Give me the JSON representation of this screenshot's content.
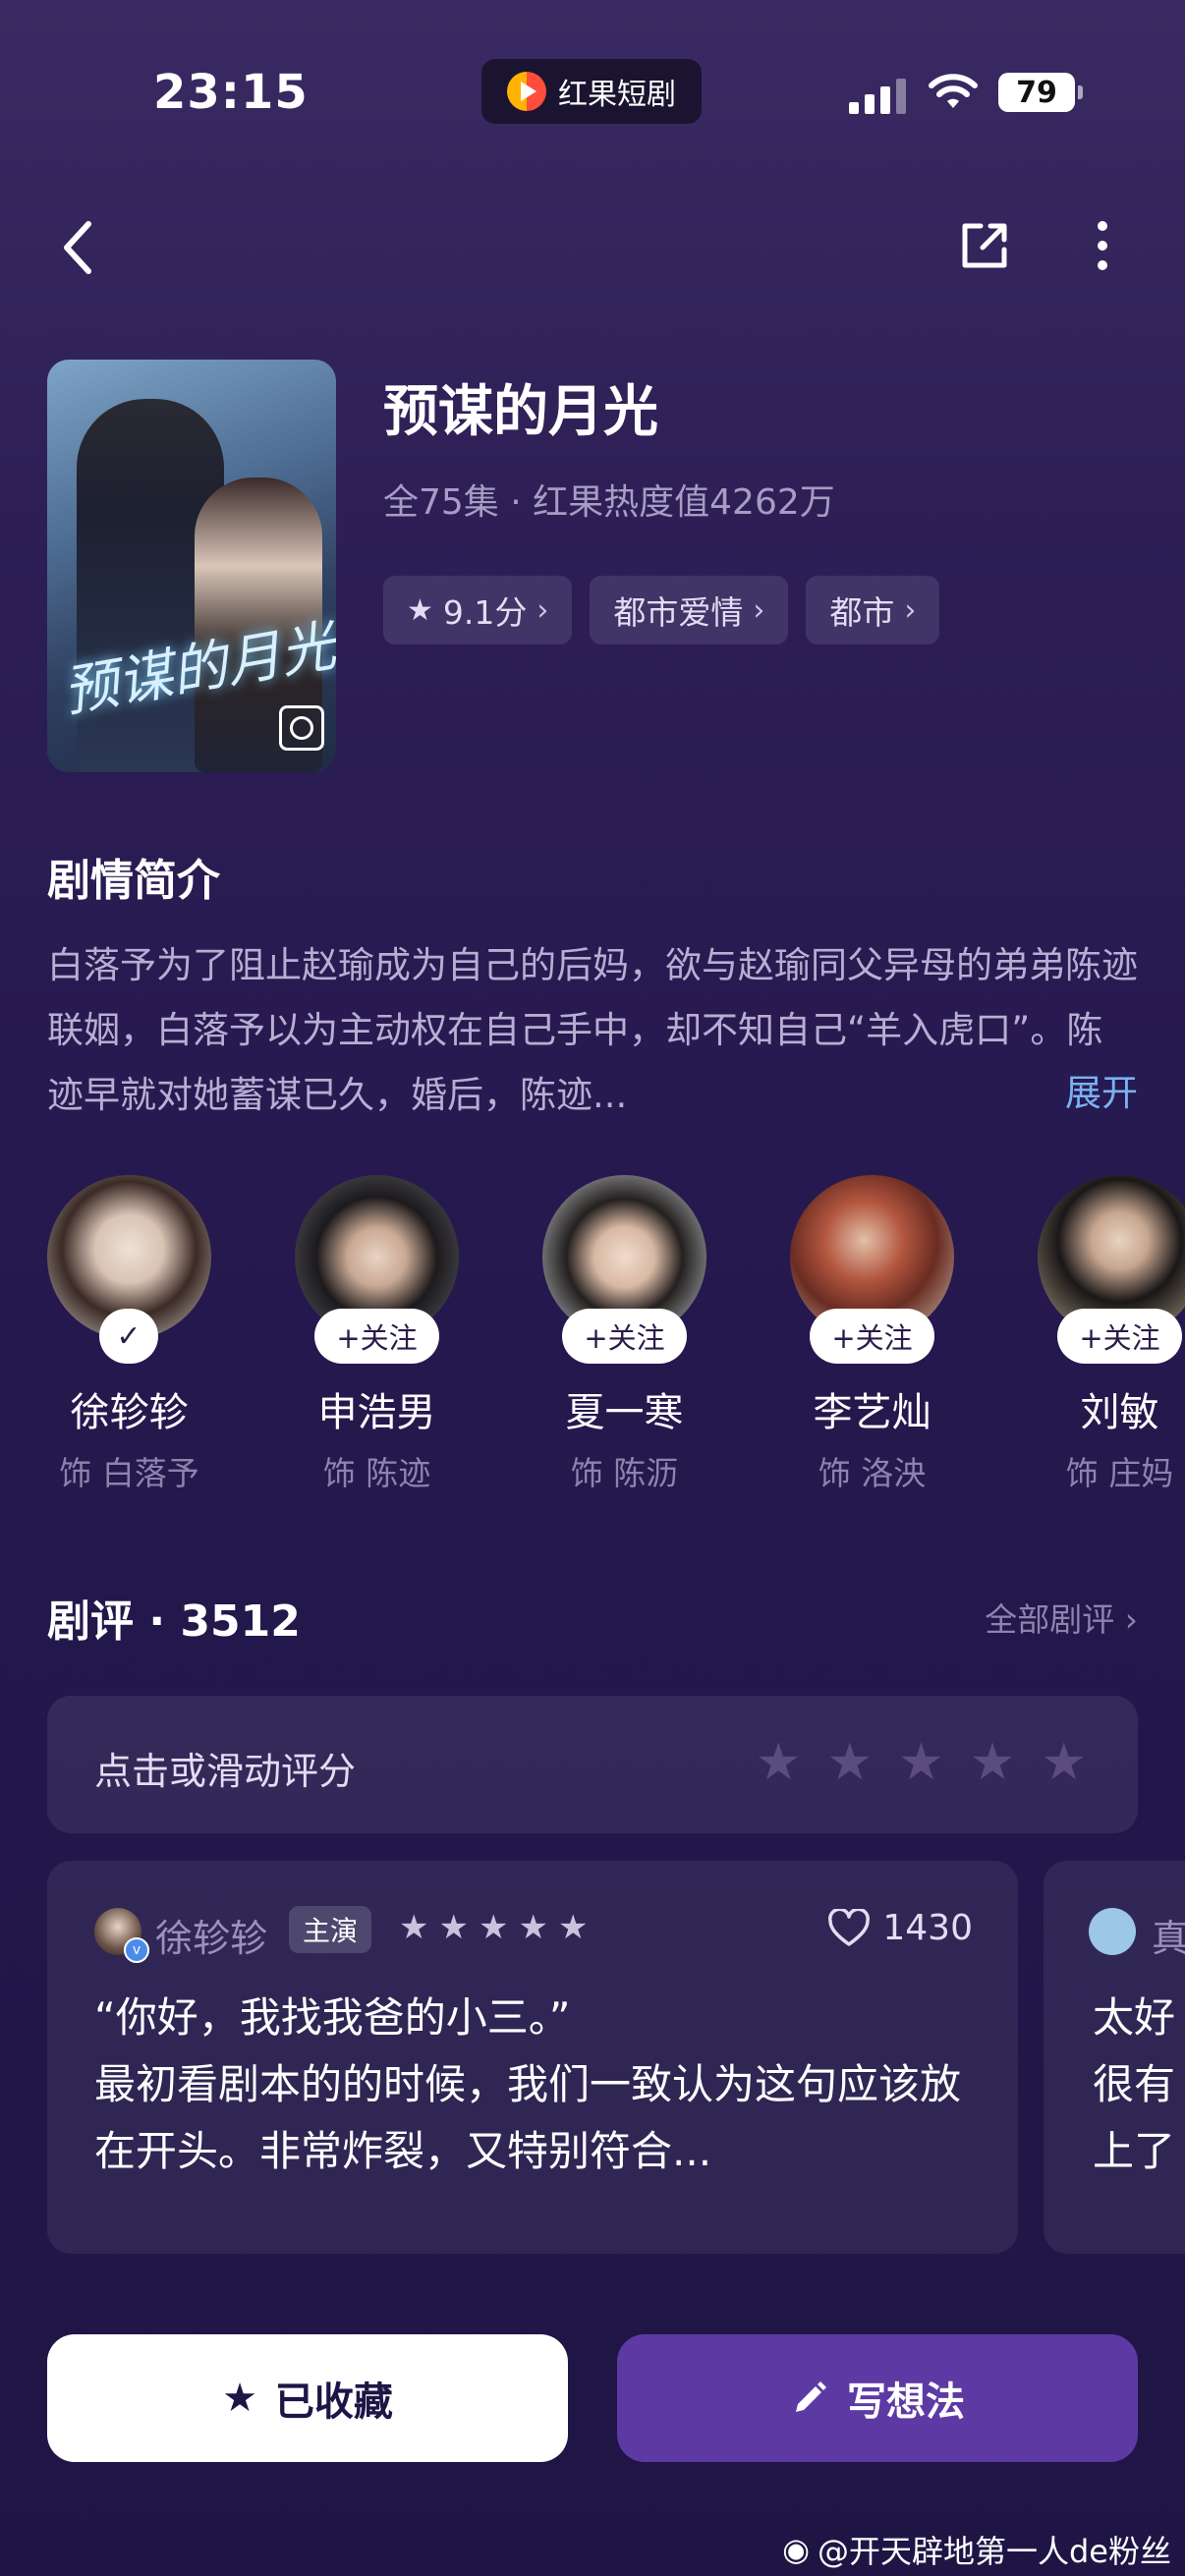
{
  "status_bar": {
    "time": "23:15",
    "app_name": "红果短剧",
    "battery": "79"
  },
  "drama": {
    "title": "预谋的月光",
    "meta": "全75集 · 红果热度值4262万",
    "cover_title": "预谋的月光",
    "tags": [
      {
        "label": "9.1分",
        "icon": "star-icon"
      },
      {
        "label": "都市爱情"
      },
      {
        "label": "都市"
      }
    ]
  },
  "synopsis": {
    "heading": "剧情简介",
    "text": "白落予为了阻止赵瑜成为自己的后妈，欲与赵瑜同父异母的弟弟陈迹联姻，白落予以为主动权在自己手中，却不知自己“羊入虎口”。陈迹早就对她蓄谋已久，婚后，陈迹...",
    "expand": "展开"
  },
  "cast": [
    {
      "name": "徐轸轸",
      "role": "饰 白落予",
      "followed": true,
      "follow_label": "✓"
    },
    {
      "name": "申浩男",
      "role": "饰 陈迹",
      "followed": false,
      "follow_label": "+关注"
    },
    {
      "name": "夏一寒",
      "role": "饰 陈沥",
      "followed": false,
      "follow_label": "+关注"
    },
    {
      "name": "李艺灿",
      "role": "饰 洛泱",
      "followed": false,
      "follow_label": "+关注"
    },
    {
      "name": "刘敏",
      "role": "饰 庄妈",
      "followed": false,
      "follow_label": "+关注"
    }
  ],
  "reviews": {
    "heading": "剧评 · 3512",
    "all_link": "全部剧评",
    "rate_prompt": "点击或滑动评分",
    "rate_max": 5,
    "items": [
      {
        "user": "徐轸轸",
        "badge": "主演",
        "stars": 5,
        "likes": "1430",
        "text": "“你好，我找我爸的小三。”\n最初看剧本的的时候，我们一致认为这句应该放在开头。非常炸裂，又特别符合..."
      },
      {
        "user": "真",
        "text": "太好\n很有\n上了"
      }
    ]
  },
  "actions": {
    "favorite": "已收藏",
    "write": "写想法"
  },
  "watermark": "@开天辟地第一人de粉丝",
  "colors": {
    "accent": "#5d3aa3",
    "link": "#7ab2f2",
    "bg": "#26194f"
  }
}
